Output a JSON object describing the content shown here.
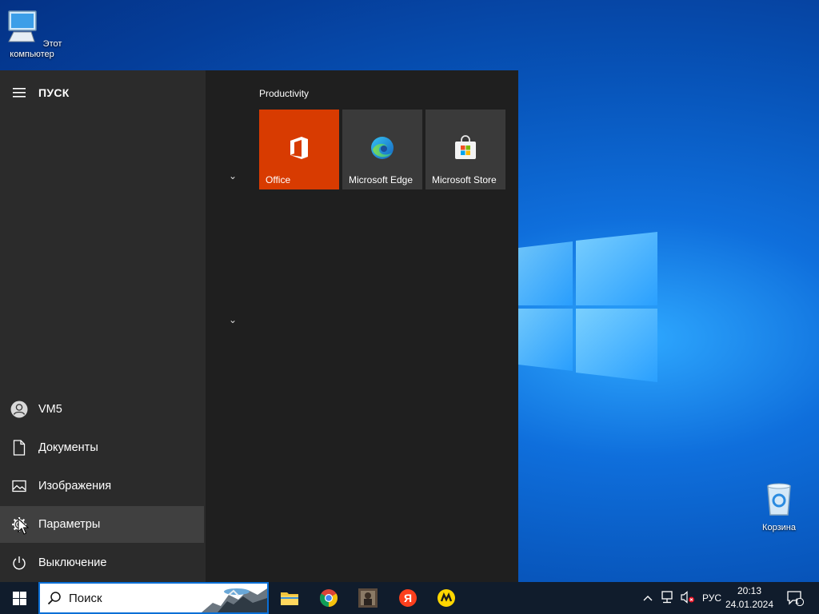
{
  "desktop": {
    "icons": [
      {
        "label": "Этот компьютер",
        "icon": "this-pc-icon"
      },
      {
        "label": "Корзина",
        "icon": "recycle-bin-icon"
      }
    ]
  },
  "start_menu": {
    "header": "ПУСК",
    "user": "VM5",
    "items": [
      {
        "label": "Документы",
        "icon": "document-icon"
      },
      {
        "label": "Изображения",
        "icon": "pictures-icon"
      },
      {
        "label": "Параметры",
        "icon": "gear-icon"
      },
      {
        "label": "Выключение",
        "icon": "power-icon"
      }
    ],
    "group_title": "Productivity",
    "tiles": [
      {
        "label": "Office",
        "icon": "office-icon",
        "color": "#d83b01"
      },
      {
        "label": "Microsoft Edge",
        "icon": "edge-icon",
        "color": "#3a3a3a"
      },
      {
        "label": "Microsoft Store",
        "icon": "store-icon",
        "color": "#3a3a3a"
      }
    ]
  },
  "taskbar": {
    "search_placeholder": "Поиск",
    "apps": [
      "file-explorer-icon",
      "chrome-icon",
      "app-thumbnail-icon",
      "yandex-browser-icon",
      "yandex-market-icon"
    ],
    "language": "РУС",
    "time": "20:13",
    "date": "24.01.2024",
    "notification_count": "1"
  },
  "colors": {
    "accent": "#0078d4",
    "office_tile": "#d83b01",
    "start_bg": "#1f1f1f",
    "start_left_bg": "#2b2b2b",
    "taskbar_bg": "#101c2c"
  }
}
